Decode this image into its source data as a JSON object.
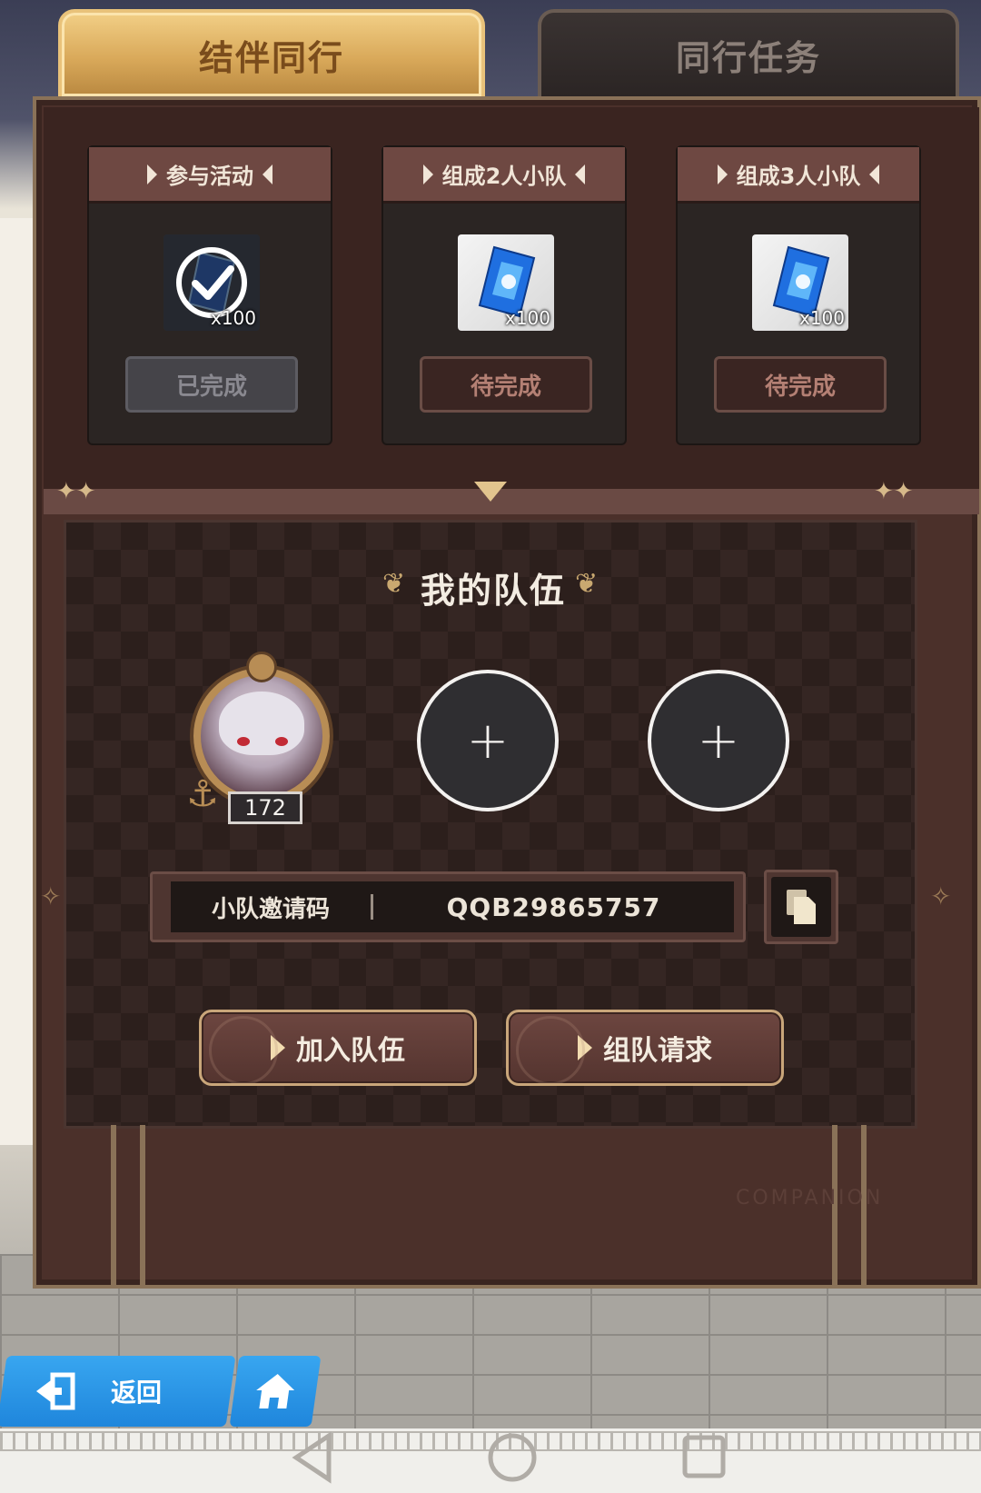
{
  "tabs": [
    {
      "label": "结伴同行",
      "active": true
    },
    {
      "label": "同行任务",
      "active": false
    }
  ],
  "tasks": [
    {
      "title": "参与活动",
      "reward_count": "x100",
      "status": "已完成",
      "completed": true
    },
    {
      "title": "组成2人小队",
      "reward_count": "x100",
      "status": "待完成",
      "completed": false
    },
    {
      "title": "组成3人小队",
      "reward_count": "x100",
      "status": "待完成",
      "completed": false
    }
  ],
  "team": {
    "title": "我的队伍",
    "leader_level": "172",
    "empty_slot_symbol": "+",
    "invite_label": "小队邀请码",
    "invite_code": "QQB29865757",
    "join_button": "加入队伍",
    "request_button": "组队请求"
  },
  "watermark": "COMPANION",
  "nav": {
    "back_label": "返回"
  },
  "colors": {
    "tab_active": "#d9a95a",
    "panel": "#4b302a",
    "nav_blue": "#1f86dc"
  }
}
